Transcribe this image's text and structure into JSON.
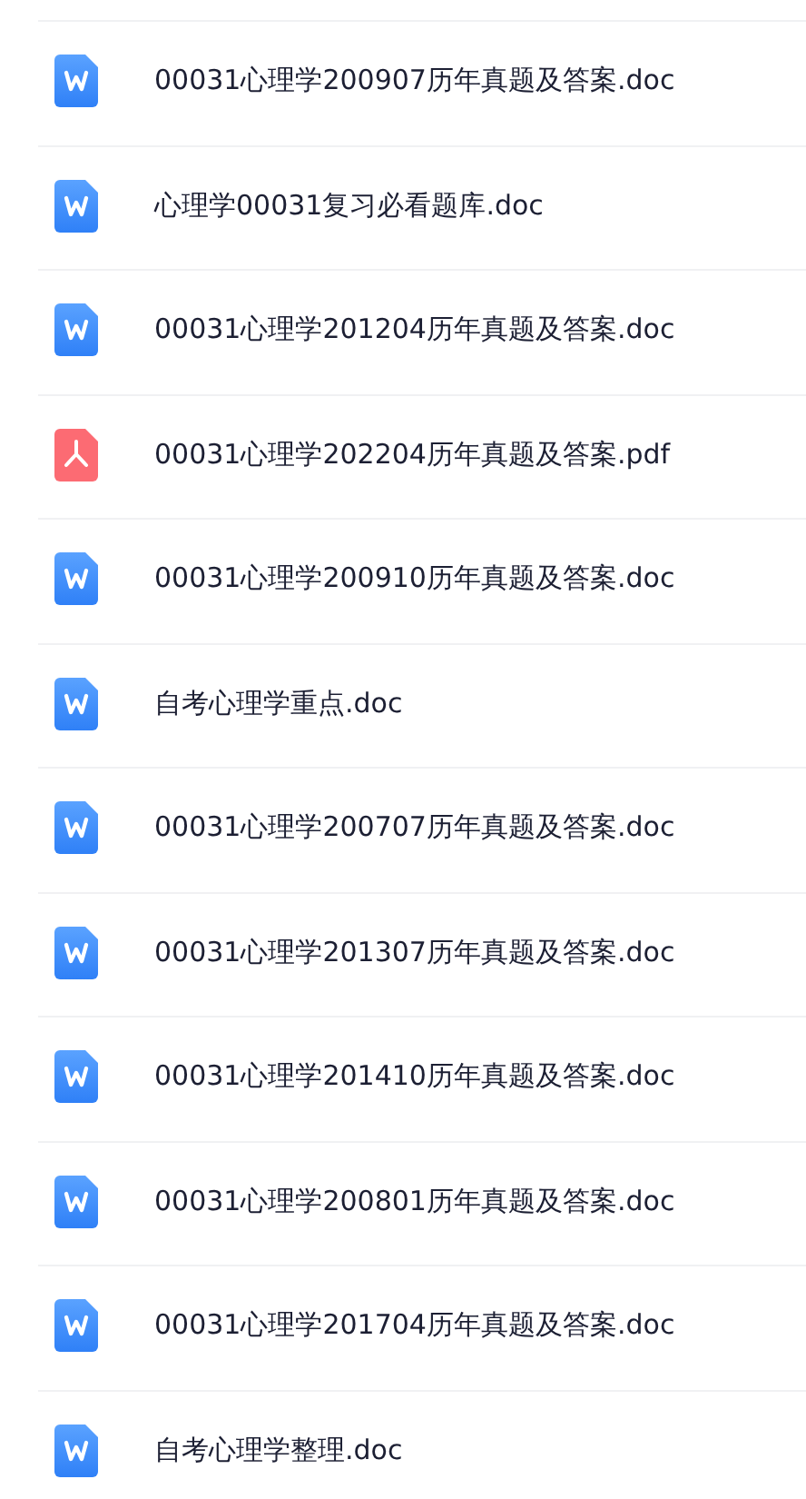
{
  "files": [
    {
      "kind": "doc",
      "name": "00031心理学200907历年真题及答案.doc"
    },
    {
      "kind": "doc",
      "name": "心理学00031复习必看题库.doc"
    },
    {
      "kind": "doc",
      "name": "00031心理学201204历年真题及答案.doc"
    },
    {
      "kind": "pdf",
      "name": "00031心理学202204历年真题及答案.pdf"
    },
    {
      "kind": "doc",
      "name": "00031心理学200910历年真题及答案.doc"
    },
    {
      "kind": "doc",
      "name": "自考心理学重点.doc"
    },
    {
      "kind": "doc",
      "name": "00031心理学200707历年真题及答案.doc"
    },
    {
      "kind": "doc",
      "name": "00031心理学201307历年真题及答案.doc"
    },
    {
      "kind": "doc",
      "name": "00031心理学201410历年真题及答案.doc"
    },
    {
      "kind": "doc",
      "name": "00031心理学200801历年真题及答案.doc"
    },
    {
      "kind": "doc",
      "name": "00031心理学201704历年真题及答案.doc"
    },
    {
      "kind": "doc",
      "name": "自考心理学整理.doc"
    }
  ]
}
